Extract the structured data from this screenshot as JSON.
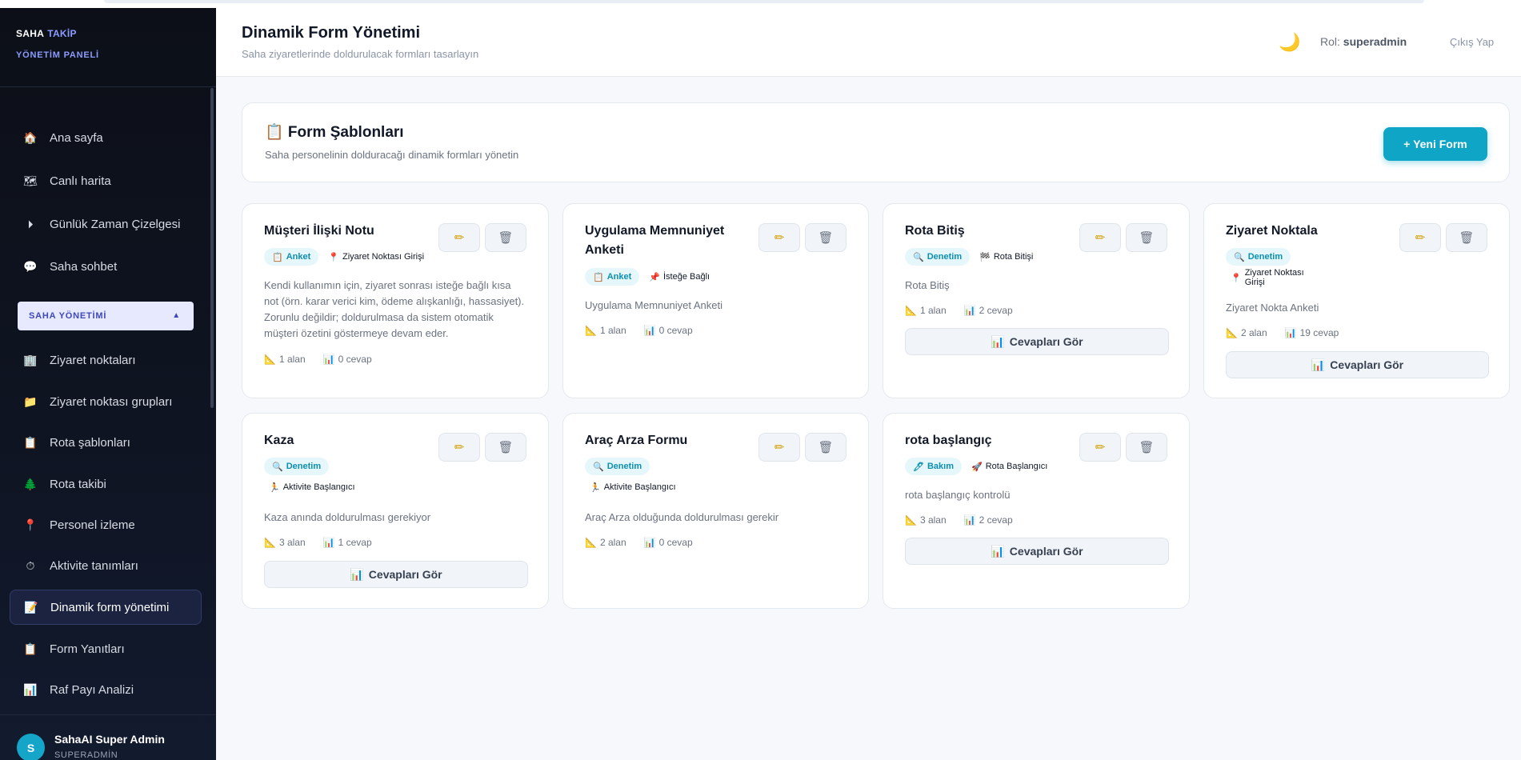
{
  "sidebar": {
    "brand_word1": "SAHA",
    "brand_word2": "TAKİP",
    "brand_sub": "YÖNETİM PANELİ",
    "top_items": [
      {
        "icon": "home-icon",
        "label": "Ana sayfa"
      },
      {
        "icon": "map-icon",
        "label": "Canlı harita"
      },
      {
        "icon": "play-circle-icon",
        "label": "Günlük Zaman Çizelgesi"
      },
      {
        "icon": "chat-icon",
        "label": "Saha sohbet"
      }
    ],
    "section_label": "SAHA YÖNETİMİ",
    "section_items": [
      {
        "icon": "building-icon",
        "label": "Ziyaret noktaları"
      },
      {
        "icon": "folder-icon",
        "label": "Ziyaret noktası grupları"
      },
      {
        "icon": "clipboard-icon",
        "label": "Rota şablonları"
      },
      {
        "icon": "tree-icon",
        "label": "Rota takibi"
      },
      {
        "icon": "pin-icon",
        "label": "Personel izleme"
      },
      {
        "icon": "stopwatch-icon",
        "label": "Aktivite tanımları"
      },
      {
        "icon": "memo-icon",
        "label": "Dinamik form yönetimi",
        "active": true
      },
      {
        "icon": "clipboard-icon",
        "label": "Form Yanıtları"
      },
      {
        "icon": "bar-chart-icon",
        "label": "Raf Payı Analizi"
      }
    ],
    "user": {
      "initial": "S",
      "name": "SahaAI Super Admin",
      "role": "SUPERADMİN"
    }
  },
  "header": {
    "title": "Dinamik Form Yönetimi",
    "subtitle": "Saha ziyaretlerinde doldurulacak formları tasarlayın",
    "role_label": "Rol:",
    "role_value": "superadmin",
    "logout": "Çıkış Yap"
  },
  "templates": {
    "title": "📋 Form Şablonları",
    "subtitle": "Saha personelinin dolduracağı dinamik formları yönetin",
    "new_button": "+ Yeni Form"
  },
  "answers_label": "Cevapları Gör",
  "forms": [
    {
      "name": "Müşteri İlişki Notu",
      "tags": [
        {
          "style": "blue",
          "icon": "📋",
          "text": "Anket"
        },
        {
          "style": "plain",
          "icon": "📍",
          "text": "Ziyaret Noktası Girişi"
        }
      ],
      "description": "Kendi kullanımın için, ziyaret sonrası isteğe bağlı kısa not (örn. karar verici kim, ödeme alışkanlığı, hassasiyet). Zorunlu değildir; doldurulmasa da sistem otomatik müşteri özetini göstermeye devam eder.",
      "fields": "1 alan",
      "answers": "0 cevap",
      "show_answers": false
    },
    {
      "name": "Uygulama Memnuniyet Anketi",
      "tags": [
        {
          "style": "blue",
          "icon": "📋",
          "text": "Anket"
        },
        {
          "style": "plain",
          "icon": "📌",
          "text": "İsteğe Bağlı"
        }
      ],
      "description": "Uygulama Memnuniyet Anketi",
      "fields": "1 alan",
      "answers": "0 cevap",
      "show_answers": false
    },
    {
      "name": "Rota Bitiş",
      "tags": [
        {
          "style": "blue",
          "icon": "🔍",
          "text": "Denetim"
        },
        {
          "style": "plain",
          "icon": "🏁",
          "text": "Rota Bitişi"
        }
      ],
      "description": "Rota Bitiş",
      "fields": "1 alan",
      "answers": "2 cevap",
      "show_answers": true
    },
    {
      "name": "Ziyaret Noktala",
      "tags": [
        {
          "style": "blue",
          "icon": "🔍",
          "text": "Denetim"
        },
        {
          "style": "plain",
          "icon": "📍",
          "text": "Ziyaret Noktası Girişi"
        }
      ],
      "description": "Ziyaret Nokta Anketi",
      "fields": "2 alan",
      "answers": "19 cevap",
      "show_answers": true
    },
    {
      "name": "Kaza",
      "tags": [
        {
          "style": "blue",
          "icon": "🔍",
          "text": "Denetim"
        },
        {
          "style": "plain",
          "icon": "🏃",
          "text": "Aktivite Başlangıcı"
        }
      ],
      "description": "Kaza anında doldurulması gerekiyor",
      "fields": "3 alan",
      "answers": "1 cevap",
      "show_answers": true
    },
    {
      "name": "Araç Arza Formu",
      "tags": [
        {
          "style": "blue",
          "icon": "🔍",
          "text": "Denetim"
        },
        {
          "style": "plain",
          "icon": "🏃",
          "text": "Aktivite Başlangıcı"
        }
      ],
      "description": "Araç Arza olduğunda doldurulması gerekir",
      "fields": "2 alan",
      "answers": "0 cevap",
      "show_answers": false
    },
    {
      "name": "rota başlangıç",
      "tags": [
        {
          "style": "blue",
          "icon": "🖊",
          "text": "Bakım"
        },
        {
          "style": "plain",
          "icon": "🚀",
          "text": "Rota Başlangıcı"
        }
      ],
      "description": "rota başlangıç kontrolü",
      "fields": "3 alan",
      "answers": "2 cevap",
      "show_answers": true
    }
  ]
}
